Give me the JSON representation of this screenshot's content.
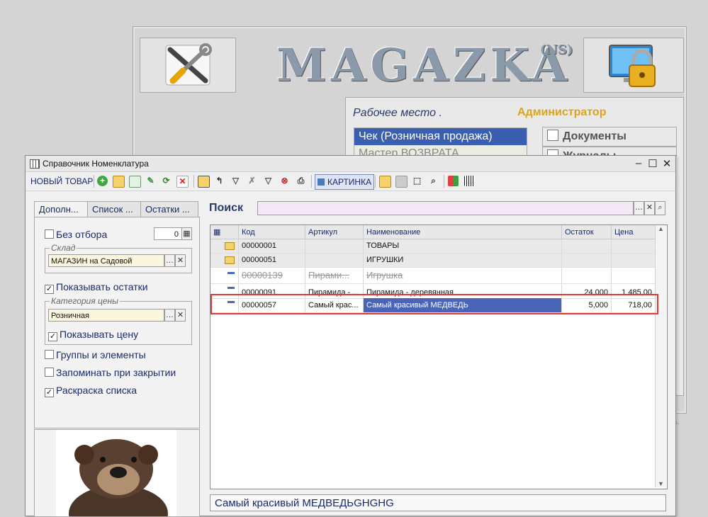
{
  "app": {
    "logo": "MAGAZKA",
    "logo_sup": "(NS)"
  },
  "workplace": {
    "label": "Рабочее место .",
    "role": "Администратор",
    "items": [
      "Чек (Розничная продажа)",
      "Мастер ВОЗВРАТА"
    ],
    "buttons": [
      "Документы",
      "Журналы"
    ]
  },
  "faded_text": "А.",
  "dialog": {
    "title": "Справочник Номенклатура",
    "toolbar": {
      "new_item": "НОВЫЙ ТОВАР",
      "picture": "КАРТИНКА"
    },
    "tabs": [
      "Дополн...",
      "Список ...",
      "Остатки ..."
    ],
    "filters": {
      "no_filter": "Без отбора",
      "no_filter_value": "0",
      "warehouse_label": "Склад",
      "warehouse_value": "МАГАЗИН на Садовой",
      "show_stock": "Показывать остатки",
      "price_cat_label": "Категория цены",
      "price_cat_value": "Розничная",
      "show_price": "Показывать цену",
      "groups_elements": "Группы и элементы",
      "remember": "Запоминать при закрытии",
      "coloring": "Раскраска списка"
    },
    "search_label": "Поиск",
    "search_value": "",
    "columns": [
      "Код",
      "Артикул",
      "Наименование",
      "Остаток",
      "Цена"
    ],
    "rows": [
      {
        "code": "00000001",
        "article": "",
        "name": "ТОВАРЫ",
        "stock": "",
        "price": ""
      },
      {
        "code": "00000051",
        "article": "",
        "name": "ИГРУШКИ",
        "stock": "",
        "price": ""
      },
      {
        "code": "00000139",
        "article": "Пирами...",
        "name": "Игрушка",
        "stock": "",
        "price": ""
      },
      {
        "code": "00000091",
        "article": "Пирамида - ...",
        "name": "Пирамида - деревянная",
        "stock": "24,000",
        "price": "1 485,00"
      },
      {
        "code": "00000057",
        "article": "Самый крас...",
        "name": "Самый красивый МЕДВЕДЬ",
        "stock": "5,000",
        "price": "718,00"
      }
    ],
    "status_text": "Самый красивый МЕДВЕДЬGHGHG"
  }
}
